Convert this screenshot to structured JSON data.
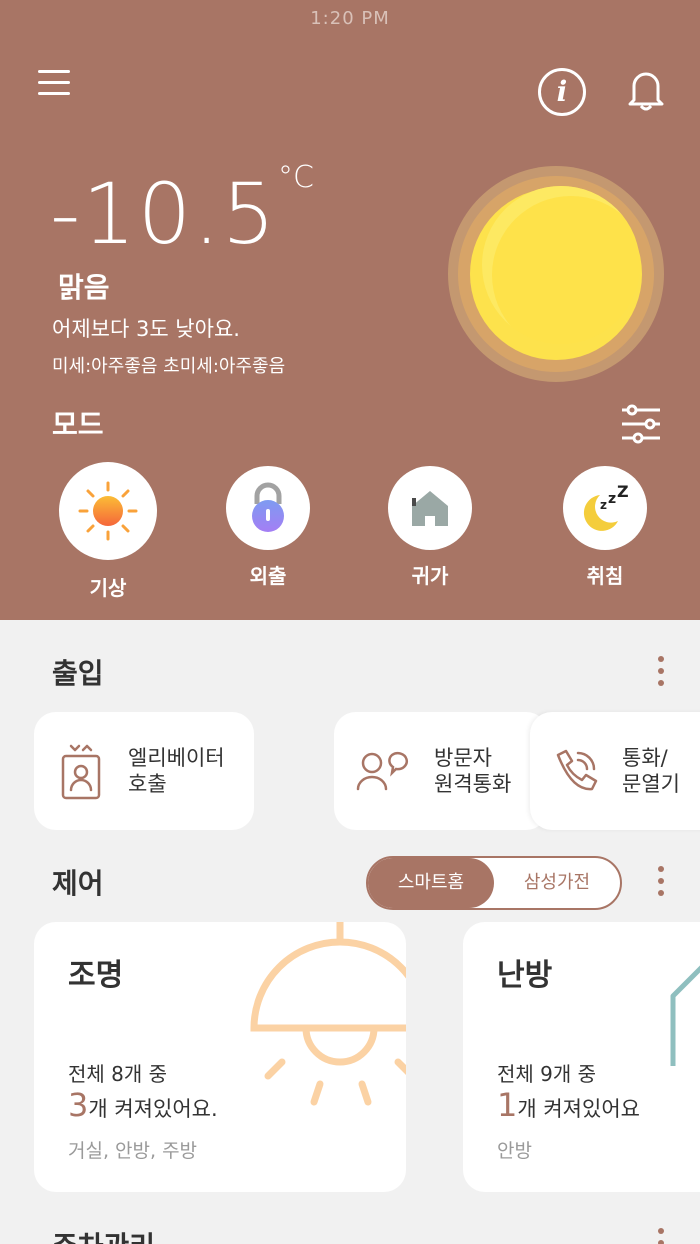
{
  "status": {
    "time": "1:20 PM"
  },
  "header": {
    "info_icon": "i"
  },
  "weather": {
    "temperature": "-10.5",
    "unit": "°C",
    "condition": "맑음",
    "comparison": "어제보다 3도 낮아요.",
    "air_quality": "미세:아주좋음 초미세:아주좋음"
  },
  "modes": {
    "title": "모드",
    "items": [
      {
        "label": "기상",
        "icon": "sun-icon"
      },
      {
        "label": "외출",
        "icon": "lock-icon"
      },
      {
        "label": "귀가",
        "icon": "home-icon"
      },
      {
        "label": "취침",
        "icon": "moon-sleep-icon"
      }
    ]
  },
  "entry": {
    "title": "출입",
    "items": [
      {
        "label": "엘리베이터\n호출",
        "icon": "elevator-icon"
      },
      {
        "label": "방문자\n원격통화",
        "icon": "visitor-icon"
      },
      {
        "label": "통화/\n문열기",
        "icon": "phone-icon"
      }
    ]
  },
  "control": {
    "title": "제어",
    "toggle": {
      "active": "스마트홈",
      "inactive": "삼성가전"
    },
    "cards": [
      {
        "title": "조명",
        "summary": "전체 8개 중",
        "count": "3",
        "suffix": "개 켜져있어요.",
        "rooms": "거실, 안방, 주방"
      },
      {
        "title": "난방",
        "summary": "전체 9개 중",
        "count": "1",
        "suffix": "개 켜져있어요",
        "rooms": "안방"
      }
    ]
  },
  "parking": {
    "title": "주차관리"
  },
  "colors": {
    "accent": "#a87565",
    "sun": "#fee24a",
    "background": "#f1f1f1"
  }
}
